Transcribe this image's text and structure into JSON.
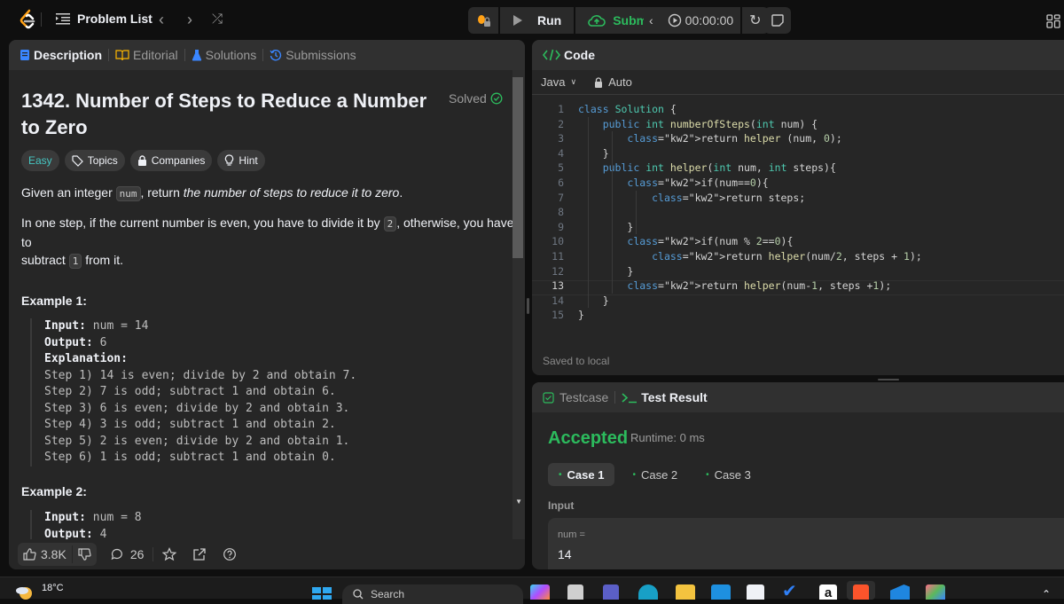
{
  "topbar": {
    "problem_list_label": "Problem List",
    "run_label": "Run",
    "submit_label": "Submit",
    "timer": "00:00:00",
    "colors": {
      "submit": "#2cbb5d",
      "logo_orange": "#ffa116"
    }
  },
  "description_panel": {
    "tabs": [
      {
        "label": "Description",
        "icon": "description-icon",
        "active": true
      },
      {
        "label": "Editorial",
        "icon": "book-icon",
        "active": false
      },
      {
        "label": "Solutions",
        "icon": "flask-icon",
        "active": false
      },
      {
        "label": "Submissions",
        "icon": "history-icon",
        "active": false
      }
    ],
    "title_line1": "1342. Number of Steps to Reduce a Number",
    "title_line2": "to Zero",
    "status": "Solved",
    "tags": {
      "difficulty": "Easy",
      "topics": "Topics",
      "companies": "Companies",
      "hint": "Hint"
    },
    "paragraph1": {
      "before": "Given an integer ",
      "code": "num",
      "middle": ", return ",
      "italic": "the number of steps to reduce it to zero",
      "after": "."
    },
    "paragraph2": {
      "part1": "In one step, if the current number is even, you have to divide it by ",
      "code1": "2",
      "part2": ", otherwise, you have to",
      "part3": "subtract ",
      "code2": "1",
      "part4": " from it."
    },
    "example1": {
      "title": "Example 1:",
      "input_label": "Input:",
      "input_value": " num = 14",
      "output_label": "Output:",
      "output_value": " 6",
      "explanation_label": "Explanation:",
      "steps": [
        "Step 1) 14 is even; divide by 2 and obtain 7.",
        "Step 2) 7 is odd; subtract 1 and obtain 6.",
        "Step 3) 6 is even; divide by 2 and obtain 3.",
        "Step 4) 3 is odd; subtract 1 and obtain 2.",
        "Step 5) 2 is even; divide by 2 and obtain 1.",
        "Step 6) 1 is odd; subtract 1 and obtain 0."
      ]
    },
    "example2": {
      "title": "Example 2:",
      "input_label": "Input:",
      "input_value": " num = 8",
      "output_label": "Output:",
      "output_value": " 4"
    },
    "footer": {
      "likes": "3.8K",
      "comments": "26"
    }
  },
  "code_panel": {
    "title": "Code",
    "language": "Java",
    "mode": "Auto",
    "current_line": 13,
    "lines": [
      "class Solution {",
      "    public int numberOfSteps(int num) {",
      "        return helper (num, 0);",
      "    }",
      "    public int helper(int num, int steps){",
      "        if(num==0){",
      "            return steps;",
      "",
      "        }",
      "        if(num % 2==0){",
      "            return helper(num/2, steps + 1);",
      "        }",
      "        return helper(num-1, steps +1);",
      "    }",
      "}"
    ],
    "saved_status": "Saved to local"
  },
  "result_panel": {
    "tabs": [
      {
        "label": "Testcase",
        "active": false
      },
      {
        "label": "Test Result",
        "active": true
      }
    ],
    "verdict": "Accepted",
    "runtime": "Runtime: 0 ms",
    "cases": [
      "Case 1",
      "Case 2",
      "Case 3"
    ],
    "active_case": 0,
    "input_heading": "Input",
    "input_var": "num =",
    "input_value": "14",
    "colors": {
      "accepted": "#2cbb5d"
    }
  },
  "taskbar": {
    "weather": "18°C",
    "search_placeholder": "Search"
  }
}
